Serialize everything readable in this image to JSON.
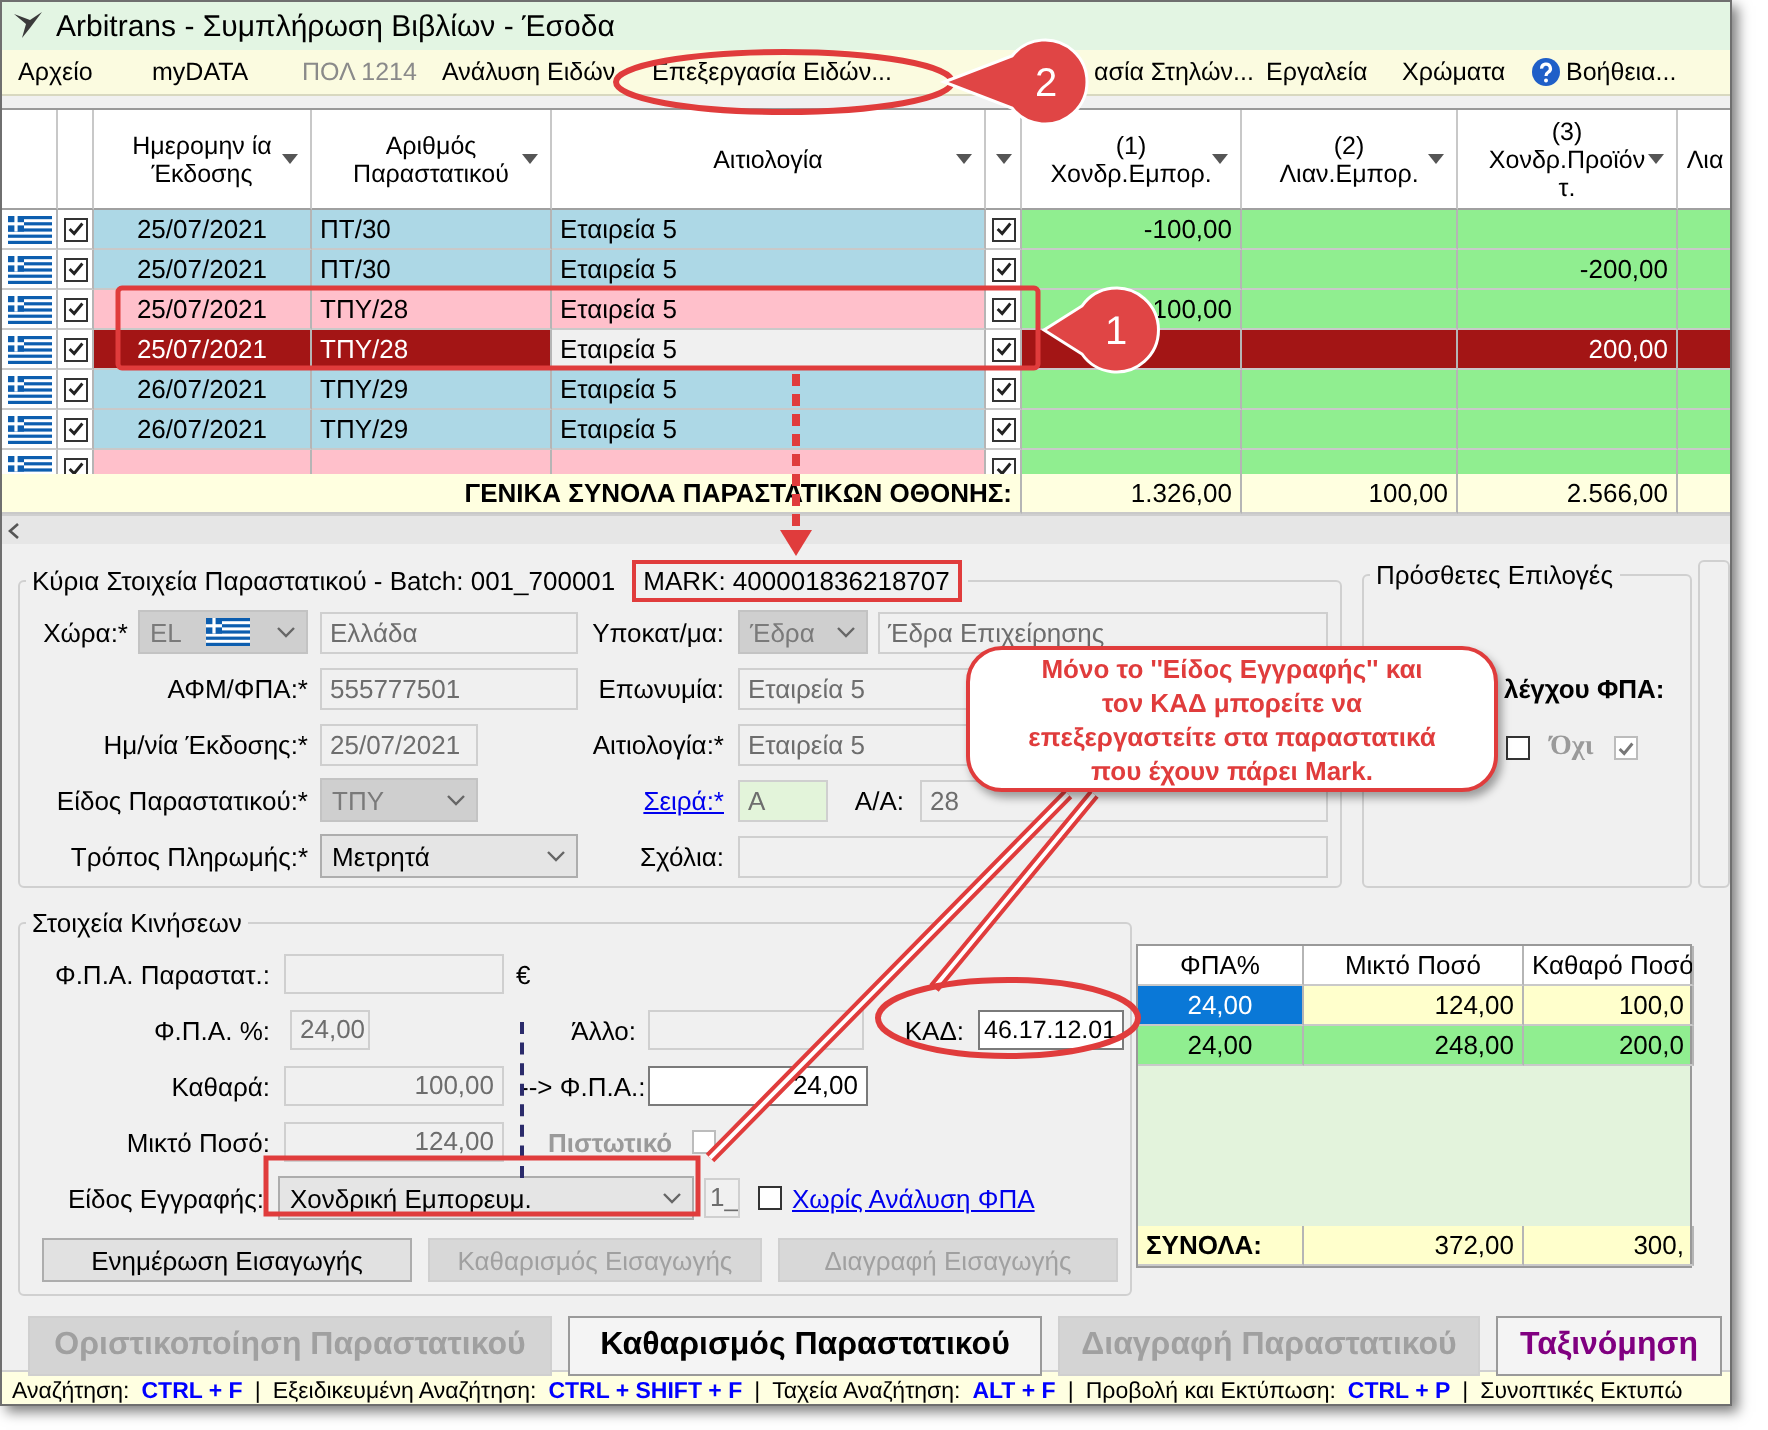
{
  "window": {
    "title": "Arbitrans - Συμπλήρωση Βιβλίων - Έσοδα"
  },
  "menu": [
    {
      "kind": "plain",
      "label": "Αρχείο",
      "disabled": false
    },
    {
      "kind": "plain",
      "label": "myDATA",
      "disabled": false
    },
    {
      "kind": "plain",
      "label": "ΠΟΛ 1214",
      "disabled": true
    },
    {
      "kind": "plain",
      "label": "Ανάλυση Ειδών",
      "disabled": false
    },
    {
      "kind": "plain",
      "label": "Επεξεργασία Ειδών...",
      "disabled": false
    },
    {
      "kind": "plain",
      "label": "ασία Στηλών...",
      "disabled": false
    },
    {
      "kind": "plain",
      "label": "Εργαλεία",
      "disabled": false
    },
    {
      "kind": "plain",
      "label": "Χρώματα",
      "disabled": false
    },
    {
      "kind": "help",
      "label": "Βοήθεια...",
      "disabled": false
    }
  ],
  "grid": {
    "columns": [
      {
        "kind": "flag"
      },
      {
        "kind": "check"
      },
      {
        "kind": "date",
        "label": "Ημερομην ία\nΈκδοσης",
        "filter": true
      },
      {
        "kind": "text",
        "label": "Αριθμός\nΠαραστατικού",
        "filter": true
      },
      {
        "kind": "text",
        "label": "Αιτιολογία",
        "filter": true
      },
      {
        "kind": "check",
        "filter": true
      },
      {
        "kind": "number",
        "label": "(1)\nΧονδρ.Εμπορ.",
        "filter": true
      },
      {
        "kind": "number",
        "label": "(2)\nΛιαν.Εμπορ.",
        "filter": true
      },
      {
        "kind": "number",
        "label": "(3)\nΧονδρ.Προϊόν\nτ.",
        "filter": true
      },
      {
        "kind": "number",
        "label": "Λια",
        "filter": false
      }
    ],
    "rows": [
      {
        "color": "#add8e6",
        "selected": false,
        "included": true,
        "date": "25/07/2021",
        "number": "ΠΤ/30",
        "reason": "Εταιρεία 5",
        "confirmed": true,
        "col_1": "-100,00"
      },
      {
        "color": "#add8e6",
        "selected": false,
        "included": true,
        "date": "25/07/2021",
        "number": "ΠΤ/30",
        "reason": "Εταιρεία 5",
        "confirmed": true,
        "col_3": "-200,00"
      },
      {
        "color": "#ffc0cb",
        "selected": false,
        "included": true,
        "date": "25/07/2021",
        "number": "ΤΠΥ/28",
        "reason": "Εταιρεία 5",
        "confirmed": true,
        "col_1": "100,00"
      },
      {
        "selected": true,
        "included": true,
        "date": "25/07/2021",
        "number": "ΤΠΥ/28",
        "reason": "Εταιρεία 5",
        "confirmed": true,
        "col_3": "200,00"
      },
      {
        "color": "#add8e6",
        "selected": false,
        "included": true,
        "date": "26/07/2021",
        "number": "ΤΠΥ/29",
        "reason": "Εταιρεία 5",
        "confirmed": true
      },
      {
        "color": "#add8e6",
        "selected": false,
        "included": true,
        "date": "26/07/2021",
        "number": "ΤΠΥ/29",
        "reason": "Εταιρεία 5",
        "confirmed": true
      },
      {
        "color": "#ffc0cb",
        "selected": false,
        "included": true,
        "confirmed": true
      }
    ],
    "totals": {
      "label": "ΓΕΝΙΚΑ ΣΥΝΟΛΑ ΠΑΡΑΣΤΑΤΙΚΩΝ ΟΘΟΝΗΣ:",
      "col_1": "1.326,00",
      "col_2": "100,00",
      "col_3": "2.566,00"
    }
  },
  "main_details": {
    "title": "Κύρια Στοιχεία Παραστατικού - Batch: 001_700001",
    "mark": "MARK: 400001836218707",
    "rows": [
      {
        "fields": [
          {
            "label": "Χώρα:*",
            "link": false,
            "controls": [
              {
                "kind": "country-combo",
                "value": "EL",
                "disabled": true
              },
              {
                "kind": "field",
                "value": "Ελλάδα",
                "disabled": true
              }
            ]
          },
          {
            "label": "Υποκατ/μα:",
            "link": false,
            "controls": [
              {
                "kind": "combo",
                "value": "Έδρα",
                "disabled": true
              },
              {
                "kind": "field",
                "value": "Έδρα Επιχείρησης",
                "disabled": true
              }
            ]
          }
        ]
      },
      {
        "fields": [
          {
            "label": "ΑΦΜ/ΦΠΑ:*",
            "link": false,
            "controls": [
              {
                "kind": "field",
                "value": "555777501",
                "disabled": true
              }
            ]
          },
          {
            "label": "Επωνυμία:",
            "link": false,
            "controls": [
              {
                "kind": "field",
                "value": "Εταιρεία 5",
                "disabled": true
              }
            ]
          }
        ]
      },
      {
        "fields": [
          {
            "label": "Ημ/νία Έκδοσης:*",
            "link": false,
            "controls": [
              {
                "kind": "field",
                "value": "25/07/2021",
                "disabled": true
              }
            ]
          },
          {
            "label": "Αιτιολογία:*",
            "link": false,
            "controls": [
              {
                "kind": "field",
                "value": "Εταιρεία 5",
                "disabled": true
              }
            ]
          }
        ]
      },
      {
        "fields": [
          {
            "label": "Είδος Παραστατικού:*",
            "link": false,
            "controls": [
              {
                "kind": "combo",
                "value": "ΤΠΥ",
                "disabled": true
              }
            ]
          },
          {
            "label": "Σειρά:*",
            "link": true,
            "controls": [
              {
                "kind": "field",
                "value": "A",
                "disabled": true,
                "highlight": true
              }
            ]
          },
          {
            "label": "Α/Α:",
            "link": false,
            "controls": [
              {
                "kind": "field",
                "value": "28",
                "disabled": true
              }
            ]
          }
        ]
      },
      {
        "fields": [
          {
            "label": "Τρόπος Πληρωμής:*",
            "link": false,
            "controls": [
              {
                "kind": "combo",
                "value": "Μετρητά",
                "disabled": false
              }
            ]
          },
          {
            "label": "Σχόλια:",
            "link": false,
            "controls": [
              {
                "kind": "field",
                "disabled": true
              }
            ]
          }
        ]
      }
    ]
  },
  "extra_options": {
    "title": "Πρόσθετες Επιλογές",
    "vat_check_label": "λέγχου ΦΠΑ:",
    "yes_checked": false,
    "no_label": "Όχι",
    "no_checked": true
  },
  "movements": {
    "title": "Στοιχεία Κινήσεων",
    "rows": [
      [
        {
          "kind": "label",
          "text": "Φ.Π.Α. Παραστατ.:"
        },
        {
          "kind": "field",
          "disabled": true
        },
        {
          "kind": "text",
          "text": "€"
        }
      ],
      [
        {
          "kind": "label",
          "text": "Φ.Π.Α. %:"
        },
        {
          "kind": "field",
          "value": "24,00",
          "disabled": true
        },
        {
          "kind": "label",
          "text": "Άλλο:"
        },
        {
          "kind": "field",
          "disabled": true
        },
        {
          "kind": "label",
          "text": "ΚΑΔ:"
        },
        {
          "kind": "field",
          "value": "46.17.12.01",
          "disabled": false
        }
      ],
      [
        {
          "kind": "label",
          "text": "Καθαρά:"
        },
        {
          "kind": "field",
          "value": "100,00",
          "disabled": true
        },
        {
          "kind": "text",
          "text": "--> Φ.Π.Α.:"
        },
        {
          "kind": "field",
          "value": "24,00",
          "disabled": false
        }
      ],
      [
        {
          "kind": "label",
          "text": "Μικτό Ποσό:"
        },
        {
          "kind": "field",
          "value": "124,00",
          "disabled": true
        },
        {
          "kind": "bold-label",
          "text": "Πιστωτικό",
          "disabled": true
        },
        {
          "kind": "checkbox",
          "checked": false,
          "disabled": true
        }
      ],
      [
        {
          "kind": "label",
          "text": "Είδος Εγγραφής:"
        },
        {
          "kind": "combo",
          "value": "Χονδρική Εμπορευμ.",
          "disabled": false
        },
        {
          "kind": "field",
          "value": "1_",
          "disabled": true
        },
        {
          "kind": "checkbox",
          "checked": false,
          "disabled": false
        },
        {
          "kind": "link",
          "text": "Χωρίς Ανάλυση ΦΠΑ"
        }
      ]
    ],
    "buttons": [
      {
        "label": "Ενημέρωση Εισαγωγής",
        "disabled": false
      },
      {
        "label": "Καθαρισμός Εισαγωγής",
        "disabled": true
      },
      {
        "label": "Διαγραφή Εισαγωγής",
        "disabled": true
      }
    ]
  },
  "vat_table": {
    "columns": [
      "ΦΠΑ%",
      "Μικτό Ποσό",
      "Καθαρό Ποσό"
    ],
    "rows": [
      {
        "cells": [
          "24,00",
          "124,00",
          "100,0"
        ],
        "color": "#ffffcc",
        "selected": true
      },
      {
        "cells": [
          "24,00",
          "248,00",
          "200,0"
        ],
        "color": "#90ee90",
        "selected": false
      }
    ],
    "totals": [
      "ΣΥΝΟΛΑ:",
      "372,00",
      "300,"
    ]
  },
  "actions": [
    {
      "label": "Οριστικοποίηση Παραστατικού",
      "disabled": true,
      "color": "#a0a0a0"
    },
    {
      "label": "Καθαρισμός Παραστατικού",
      "disabled": false,
      "color": "#000000"
    },
    {
      "label": "Διαγραφή Παραστατικού",
      "disabled": true,
      "color": "#a0a0a0"
    },
    {
      "label": "Ταξινόμηση",
      "disabled": false,
      "color": "#800080"
    }
  ],
  "status_bar": [
    {
      "kind": "label",
      "text": "Αναζήτηση:"
    },
    {
      "kind": "key",
      "text": "CTRL + F"
    },
    {
      "kind": "separator",
      "text": "|"
    },
    {
      "kind": "label",
      "text": "Εξειδικευμένη Αναζήτηση:"
    },
    {
      "kind": "key",
      "text": "CTRL + SHIFT + F"
    },
    {
      "kind": "separator",
      "text": "|"
    },
    {
      "kind": "label",
      "text": "Ταχεία Αναζήτηση:"
    },
    {
      "kind": "key",
      "text": "ALT + F"
    },
    {
      "kind": "separator",
      "text": "|"
    },
    {
      "kind": "label",
      "text": "Προβολή και Εκτύπωση:"
    },
    {
      "kind": "key",
      "text": "CTRL + P"
    },
    {
      "kind": "separator",
      "text": "|"
    },
    {
      "kind": "label",
      "text": "Συνοπτικές Εκτυπώ"
    }
  ],
  "annotations": {
    "menu_badge": "2",
    "row_badge": "1",
    "note": "Μόνο το ''Είδος Εγγραφής'' και\nτον ΚΑΔ μπορείτε να\nεπεξεργαστείτε στα παραστατικά\nπου έχουν πάρει Mark."
  }
}
